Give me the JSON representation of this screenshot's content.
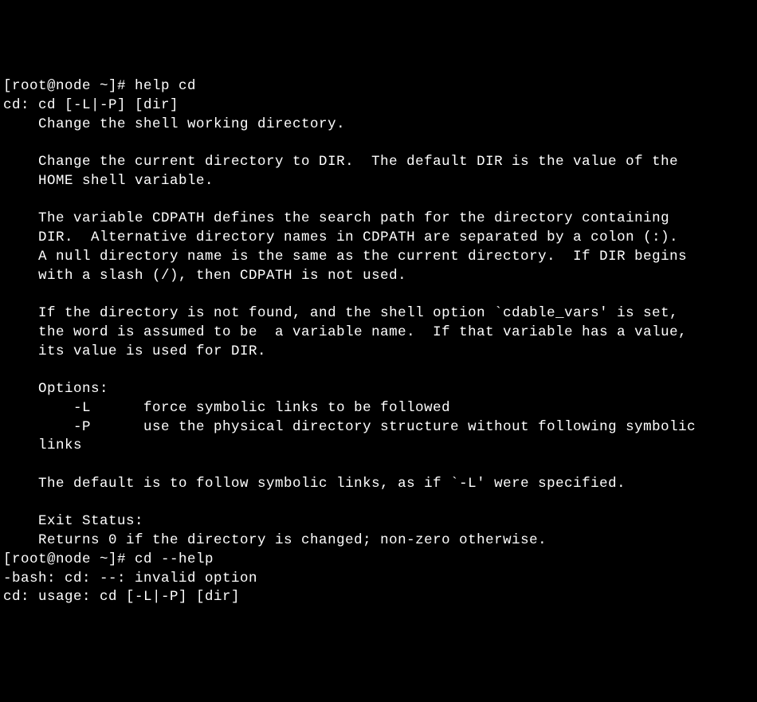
{
  "terminal": {
    "lines": [
      "[root@node ~]# help cd",
      "cd: cd [-L|-P] [dir]",
      "    Change the shell working directory.",
      "",
      "    Change the current directory to DIR.  The default DIR is the value of the",
      "    HOME shell variable.",
      "",
      "    The variable CDPATH defines the search path for the directory containing",
      "    DIR.  Alternative directory names in CDPATH are separated by a colon (:).",
      "    A null directory name is the same as the current directory.  If DIR begins",
      "    with a slash (/), then CDPATH is not used.",
      "",
      "    If the directory is not found, and the shell option `cdable_vars' is set,",
      "    the word is assumed to be  a variable name.  If that variable has a value,",
      "    its value is used for DIR.",
      "",
      "    Options:",
      "        -L      force symbolic links to be followed",
      "        -P      use the physical directory structure without following symbolic",
      "    links",
      "",
      "    The default is to follow symbolic links, as if `-L' were specified.",
      "",
      "    Exit Status:",
      "    Returns 0 if the directory is changed; non-zero otherwise.",
      "[root@node ~]# cd --help",
      "-bash: cd: --: invalid option",
      "cd: usage: cd [-L|-P] [dir]"
    ]
  }
}
